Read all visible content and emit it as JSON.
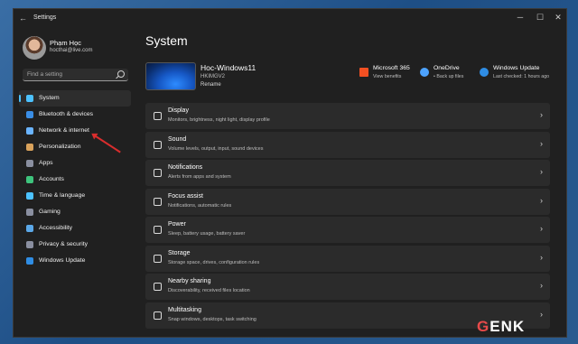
{
  "window": {
    "app_title": "Settings",
    "back": "←",
    "min": "─",
    "max": "☐",
    "close": "✕"
  },
  "user": {
    "name": "Phạm Học",
    "email": "hocthai@live.com"
  },
  "search": {
    "placeholder": "Find a setting"
  },
  "sidebar": {
    "items": [
      {
        "label": "System",
        "color": "#4cc2ff",
        "active": true
      },
      {
        "label": "Bluetooth & devices",
        "color": "#3a8ee6"
      },
      {
        "label": "Network & internet",
        "color": "#6ab4ff"
      },
      {
        "label": "Personalization",
        "color": "#d9a25b"
      },
      {
        "label": "Apps",
        "color": "#8a8fa0"
      },
      {
        "label": "Accounts",
        "color": "#3ec47d"
      },
      {
        "label": "Time & language",
        "color": "#4cc2ff"
      },
      {
        "label": "Gaming",
        "color": "#8a8fa0"
      },
      {
        "label": "Accessibility",
        "color": "#5ba8e8"
      },
      {
        "label": "Privacy & security",
        "color": "#8a8fa0"
      },
      {
        "label": "Windows Update",
        "color": "#2f8de4"
      }
    ]
  },
  "page": {
    "title": "System"
  },
  "device": {
    "name": "Hoc-Windows11",
    "model": "HKIMGV2",
    "rename": "Rename"
  },
  "quick": [
    {
      "title": "Microsoft 365",
      "sub": "View benefits",
      "icon": "microsoft-365-icon",
      "color": "#f25022"
    },
    {
      "title": "OneDrive",
      "sub": "• Back up files",
      "icon": "onedrive-icon",
      "color": "#4da3ff"
    },
    {
      "title": "Windows Update",
      "sub": "Last checked: 1 hours ago",
      "icon": "windows-update-icon",
      "color": "#2f8de4"
    }
  ],
  "cards": [
    {
      "title": "Display",
      "sub": "Monitors, brightness, night light, display profile"
    },
    {
      "title": "Sound",
      "sub": "Volume levels, output, input, sound devices"
    },
    {
      "title": "Notifications",
      "sub": "Alerts from apps and system"
    },
    {
      "title": "Focus assist",
      "sub": "Notifications, automatic rules"
    },
    {
      "title": "Power",
      "sub": "Sleep, battery usage, battery saver"
    },
    {
      "title": "Storage",
      "sub": "Storage space, drives, configuration rules"
    },
    {
      "title": "Nearby sharing",
      "sub": "Discoverability, received files location"
    },
    {
      "title": "Multitasking",
      "sub": "Snap windows, desktops, task switching"
    }
  ],
  "chevron": "›",
  "watermark": "GENK"
}
